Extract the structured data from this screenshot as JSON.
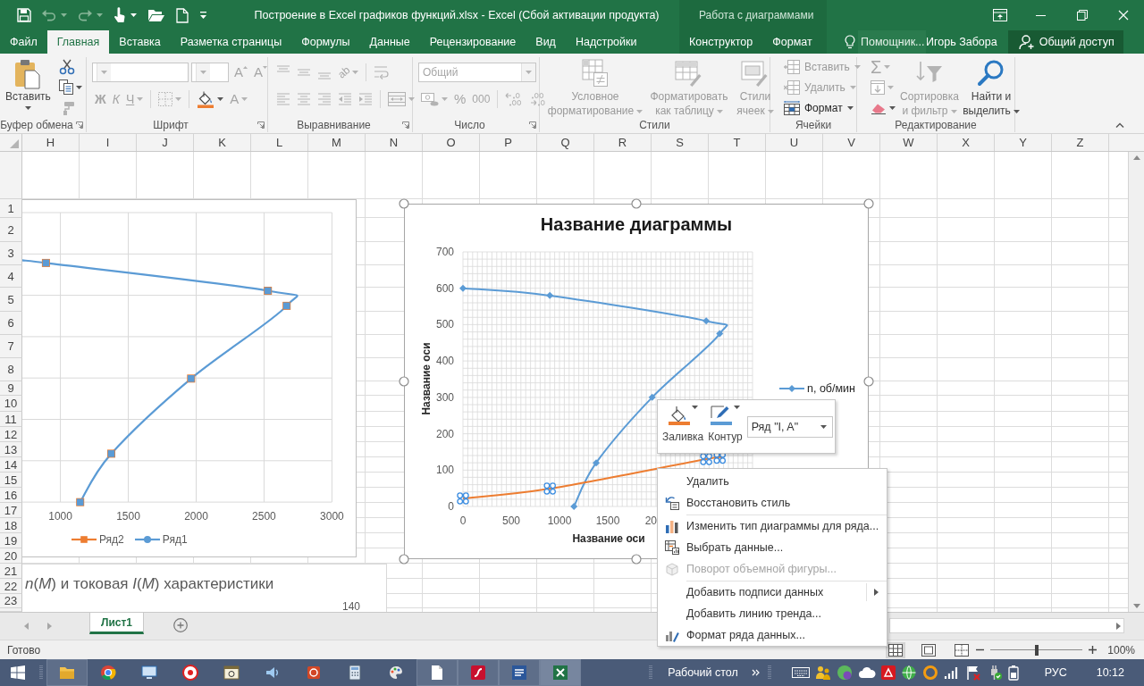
{
  "title_bar": {
    "title": "Построение в Excel графиков функций.xlsx - Excel (Сбой активации продукта)",
    "context_label": "Работа с диаграммами",
    "quick_access": [
      {
        "disabled": false,
        "dropdown": false
      },
      {
        "disabled": true,
        "dropdown": true
      },
      {
        "disabled": true,
        "dropdown": true
      },
      {
        "disabled": false,
        "dropdown": true
      },
      {
        "disabled": false,
        "dropdown": false
      },
      {
        "disabled": false,
        "dropdown": false
      }
    ]
  },
  "tabs": [
    {
      "label": "Файл",
      "selected": false,
      "kind": "main"
    },
    {
      "label": "Главная",
      "selected": true,
      "kind": "main"
    },
    {
      "label": "Вставка",
      "selected": false,
      "kind": "main"
    },
    {
      "label": "Разметка страницы",
      "selected": false,
      "kind": "main"
    },
    {
      "label": "Формулы",
      "selected": false,
      "kind": "main"
    },
    {
      "label": "Данные",
      "selected": false,
      "kind": "main"
    },
    {
      "label": "Рецензирование",
      "selected": false,
      "kind": "main"
    },
    {
      "label": "Вид",
      "selected": false,
      "kind": "main"
    },
    {
      "label": "Надстройки",
      "selected": false,
      "kind": "main"
    },
    {
      "label": "Конструктор",
      "selected": false,
      "kind": "context"
    },
    {
      "label": "Формат",
      "selected": false,
      "kind": "context"
    }
  ],
  "tell_me": {
    "placeholder": "Помощник..."
  },
  "user": {
    "name": "Игорь Забора"
  },
  "share": {
    "label": "Общий доступ"
  },
  "ribbon": {
    "clipboard": {
      "label": "Буфер обмена",
      "paste": {
        "label": "Вставить"
      },
      "tools": [
        {
          "disabled": false,
          "dropdown": false
        },
        {
          "disabled": false,
          "dropdown": true
        },
        {
          "disabled": true,
          "dropdown": false
        }
      ]
    },
    "font": {
      "label": "Шрифт",
      "tools": [
        {
          "glyph": "A",
          "disabled": true,
          "dropdown": false
        },
        {
          "glyph": "A",
          "disabled": true,
          "dropdown": false
        },
        {
          "glyph": "Ж",
          "disabled": true,
          "dropdown": false
        },
        {
          "glyph": "К",
          "disabled": true,
          "dropdown": false
        },
        {
          "glyph": "Ч",
          "disabled": true,
          "dropdown": true
        },
        {
          "disabled": true,
          "dropdown": true
        },
        {
          "disabled": false,
          "dropdown": true
        },
        {
          "glyph": "A",
          "disabled": true,
          "dropdown": true
        }
      ]
    },
    "alignment": {
      "label": "Выравнивание",
      "tools": [
        {
          "disabled": true,
          "dropdown": false
        },
        {
          "disabled": true,
          "dropdown": false
        },
        {
          "disabled": true,
          "dropdown": false
        },
        {
          "glyph": "ab",
          "disabled": true,
          "dropdown": true
        },
        {
          "disabled": true,
          "dropdown": false
        },
        {
          "disabled": true,
          "dropdown": false
        },
        {
          "disabled": true,
          "dropdown": false
        },
        {
          "disabled": true,
          "dropdown": false
        },
        {
          "disabled": true,
          "dropdown": false
        },
        {
          "disabled": true,
          "dropdown": false
        },
        {
          "disabled": true,
          "dropdown": true
        }
      ]
    },
    "number": {
      "label": "Число",
      "format": {
        "value": "Общий",
        "disabled": true
      },
      "tools": [
        {
          "disabled": true,
          "dropdown": true
        },
        {
          "glyph": "%",
          "disabled": true,
          "dropdown": false
        },
        {
          "glyph": "000",
          "disabled": true,
          "dropdown": false
        },
        {
          "disabled": true,
          "dropdown": false
        },
        {
          "disabled": true,
          "dropdown": false
        }
      ]
    },
    "styles": {
      "label": "Стили",
      "buttons": [
        {
          "label": "Условное форматирование",
          "disabled": true,
          "dropdown": true
        },
        {
          "label": "Форматировать как таблицу",
          "disabled": true,
          "dropdown": true
        },
        {
          "label": "Стили ячеек",
          "disabled": true,
          "dropdown": true
        }
      ]
    },
    "cells": {
      "label": "Ячейки",
      "buttons": [
        {
          "label": "Вставить",
          "disabled": true,
          "dropdown": true
        },
        {
          "label": "Удалить",
          "disabled": true,
          "dropdown": true
        },
        {
          "label": "Формат",
          "disabled": false,
          "dropdown": true
        }
      ]
    },
    "editing": {
      "label": "Редактирование",
      "tools": [
        {
          "glyph": "Σ",
          "disabled": true,
          "dropdown": true
        },
        {
          "disabled": true,
          "dropdown": true
        },
        {
          "disabled": false,
          "dropdown": true
        }
      ],
      "buttons": [
        {
          "label": "Сортировка и фильтр",
          "disabled": true,
          "dropdown": true
        },
        {
          "label": "Найти и выделить",
          "disabled": false,
          "dropdown": true
        }
      ]
    }
  },
  "sheet": {
    "columns": [
      "H",
      "I",
      "J",
      "K",
      "L",
      "M",
      "N",
      "O",
      "P",
      "Q",
      "R",
      "S",
      "T",
      "U",
      "V",
      "W",
      "X",
      "Y",
      "Z"
    ],
    "rows": [
      "1",
      "2",
      "3",
      "4",
      "5",
      "6",
      "7",
      "8",
      "9",
      "10",
      "11",
      "12",
      "13",
      "14",
      "15",
      "16",
      "17",
      "18",
      "19",
      "20",
      "21",
      "22",
      "23"
    ]
  },
  "charts": [
    {
      "kind": "snapshot",
      "x_tick_labels": [
        "1000",
        "1500",
        "2000",
        "2500",
        "3000"
      ],
      "legend": [
        {
          "name": "Ряд2",
          "color": "#ed7d31",
          "kind": "square"
        },
        {
          "name": "Ряд1",
          "color": "#5b9bd5",
          "kind": "circle"
        }
      ]
    },
    {
      "kind": "scatter",
      "selected": true,
      "series_selected": [
        false,
        true
      ],
      "cut_tick_label": "20",
      "chart_data": {
        "type": "line",
        "title": "Название диаграммы",
        "xlabel": "Название оси",
        "ylabel": "Название оси",
        "grid": true,
        "x": [
          0,
          900,
          2520,
          2660,
          1960,
          1380,
          1150
        ],
        "series": [
          {
            "name": "n, об/мин",
            "color": "#5b9bd5",
            "marker": "diamond",
            "values": [
              600,
              580,
              510,
              475,
              300,
              120,
              0
            ]
          },
          {
            "color": "#ed7d31",
            "values": [
              22,
              49,
              130,
              134,
              null,
              null,
              null
            ]
          }
        ],
        "xlim": [
          0,
          3000
        ],
        "ylim": [
          0,
          700
        ],
        "xticks": [
          0,
          500,
          1000,
          1500
        ],
        "yticks": [
          0,
          100,
          200,
          300,
          400,
          500,
          600,
          700
        ]
      }
    },
    {
      "kind": "caption",
      "title": "*n*(*M*) и токовая  *I*(*M*) характеристики",
      "y_tick_label": "140"
    }
  ],
  "format_toolbar": {
    "buttons": [
      {
        "label": "Заливка"
      },
      {
        "label": "Контур"
      }
    ],
    "series_select": {
      "value": "Ряд \"I, A\""
    }
  },
  "context_menu": {
    "sections": [
      {
        "items": [
          {
            "label": "Удалить",
            "disabled": false,
            "submenu": false
          },
          {
            "label": "Восстановить стиль",
            "disabled": false,
            "submenu": false
          }
        ]
      },
      {
        "items": [
          {
            "label": "Изменить тип диаграммы для ряда...",
            "disabled": false,
            "submenu": false
          },
          {
            "label": "Выбрать данные...",
            "disabled": false,
            "submenu": false
          },
          {
            "label": "Поворот объемной фигуры...",
            "disabled": true,
            "submenu": false
          }
        ]
      },
      {
        "items": [
          {
            "label": "Добавить подписи данных",
            "disabled": false,
            "submenu": true
          },
          {
            "label": "Добавить линию тренда...",
            "disabled": false,
            "submenu": false
          },
          {
            "label": "Формат ряда данных...",
            "disabled": false,
            "submenu": false
          }
        ]
      }
    ]
  },
  "sheet_tabs": [
    {
      "label": "Лист1",
      "selected": true
    }
  ],
  "status_bar": {
    "text": "Готово",
    "views": [
      {
        "selected": true
      },
      {
        "selected": false
      },
      {
        "selected": false
      }
    ],
    "zoom": {
      "level": 0.5,
      "label": "100%"
    }
  },
  "taskbar": {
    "apps": [
      {
        "running": true,
        "active": false
      },
      {
        "running": false,
        "active": false
      },
      {
        "running": false,
        "active": false
      },
      {
        "running": false,
        "active": false
      },
      {
        "running": false,
        "active": false
      },
      {
        "running": false,
        "active": false
      },
      {
        "running": false,
        "active": false
      },
      {
        "running": false,
        "active": false
      },
      {
        "running": false,
        "active": false
      },
      {
        "running": true,
        "active": false
      },
      {
        "running": true,
        "active": false
      },
      {
        "running": true,
        "active": false
      },
      {
        "running": true,
        "active": true
      }
    ],
    "toolbar_label": "Рабочий стол",
    "language": "РУС",
    "time": "10:12"
  }
}
